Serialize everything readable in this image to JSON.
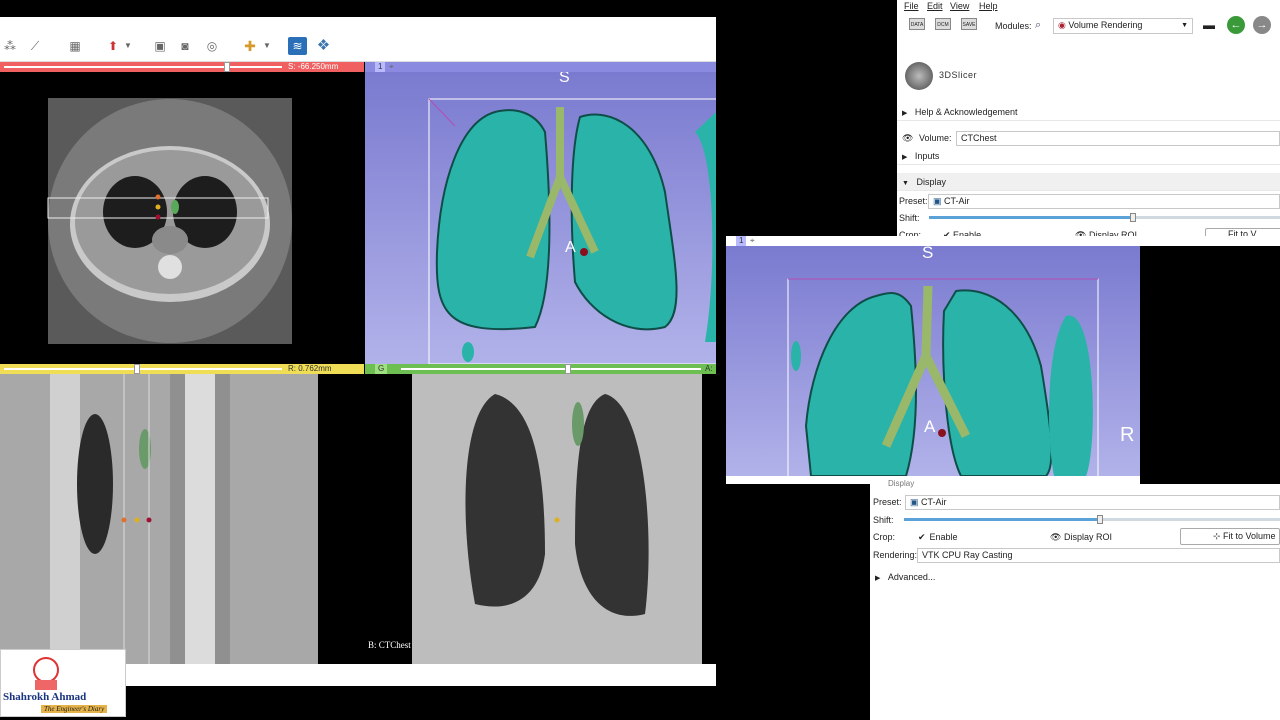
{
  "left_window": {
    "red_view": {
      "offset_label": "S: -66.250mm",
      "slice": 0.55
    },
    "yellow_view": {
      "offset_label": "R: 0.762mm",
      "slice": 0.48
    },
    "green_view": {
      "label": "G",
      "offset_label": "A:",
      "slice": 0.55,
      "volume_label": "B: CTChest"
    },
    "threed_view": {
      "label": "1",
      "orientation_top": "S",
      "orientation_center": "A"
    }
  },
  "menu": {
    "file": "File",
    "edit": "Edit",
    "view": "View",
    "help": "Help"
  },
  "module_toolbar": {
    "data_label": "DATA",
    "dcm_label": "DCM",
    "save_label": "SAVE",
    "modules_label": "Modules:",
    "module_selected": "Volume Rendering"
  },
  "logo": {
    "text": "3DSlicer"
  },
  "sections": {
    "help": "Help & Acknowledgement",
    "volume_label": "Volume:",
    "volume_value": "CTChest",
    "inputs": "Inputs",
    "display": "Display"
  },
  "display_top": {
    "preset_label": "Preset:",
    "preset_value": "CT-Air",
    "shift_label": "Shift:",
    "shift_value": 0.58,
    "crop_label": "Crop:",
    "enable_label": "Enable",
    "display_roi_label": "Display ROI",
    "fit_label": "Fit to V"
  },
  "display_bottom": {
    "section_partial": "Display",
    "preset_label": "Preset:",
    "preset_value": "CT-Air",
    "shift_label": "Shift:",
    "shift_value": 0.52,
    "crop_label": "Crop:",
    "enable_label": "Enable",
    "display_roi_label": "Display ROI",
    "fit_label": "Fit to Volume",
    "rendering_label": "Rendering:",
    "rendering_value": "VTK CPU Ray Casting",
    "advanced_label": "Advanced..."
  },
  "popout_3d": {
    "label": "1",
    "orientation_top": "S",
    "orientation_center": "A",
    "orientation_right": "R"
  },
  "watermark": {
    "name": "Shahrokh Ahmad",
    "tagline": "The Engineer's Diary"
  },
  "colors": {
    "red_bar": "#f06060",
    "yellow_bar": "#eedd55",
    "green_bar": "#6cbf50",
    "threed_bar": "#8a8ae0",
    "threed_bg": "#9b9be0",
    "lung": "#2ab3a8",
    "airway": "#9ab86a"
  }
}
